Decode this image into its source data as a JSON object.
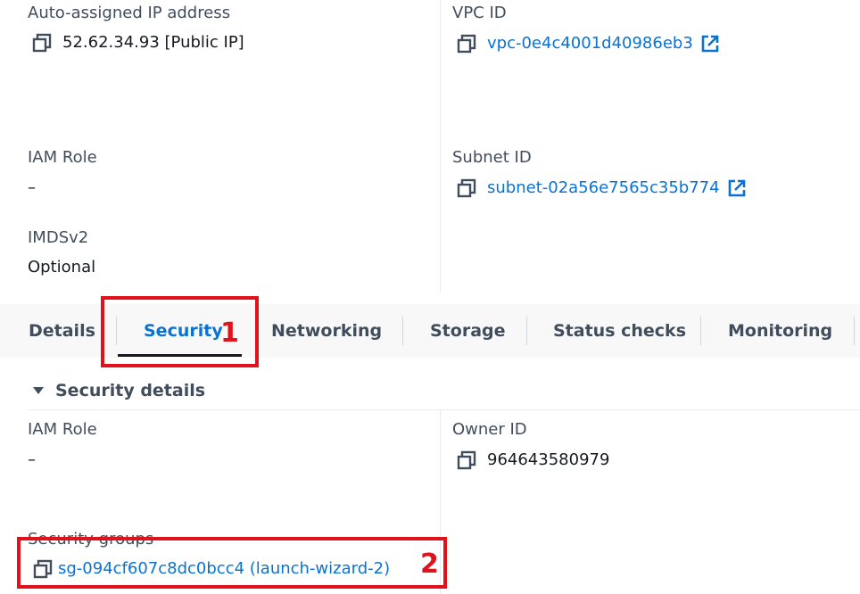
{
  "instance_details": {
    "auto_ip_label": "Auto-assigned IP address",
    "auto_ip_value": "52.62.34.93 [Public IP]",
    "vpc_label": "VPC ID",
    "vpc_value": "vpc-0e4c4001d40986eb3",
    "iam_role_label": "IAM Role",
    "iam_role_value": "–",
    "subnet_label": "Subnet ID",
    "subnet_value": "subnet-02a56e7565c35b774",
    "imds_label": "IMDSv2",
    "imds_value": "Optional"
  },
  "tabs": [
    {
      "label": "Details"
    },
    {
      "label": "Security"
    },
    {
      "label": "Networking"
    },
    {
      "label": "Storage"
    },
    {
      "label": "Status checks"
    },
    {
      "label": "Monitoring"
    }
  ],
  "active_tab": "Security",
  "security_details": {
    "heading": "Security details",
    "iam_role_label": "IAM Role",
    "iam_role_value": "–",
    "owner_label": "Owner ID",
    "owner_value": "964643580979",
    "sg_label": "Security groups",
    "sg_value": "sg-094cf607c8dc0bcc4 (launch-wizard-2)"
  },
  "annotations": [
    {
      "number": "1"
    },
    {
      "number": "2"
    }
  ],
  "colors": {
    "link": "#0972d3",
    "annotation": "#e0121b",
    "label": "#414d5c"
  }
}
